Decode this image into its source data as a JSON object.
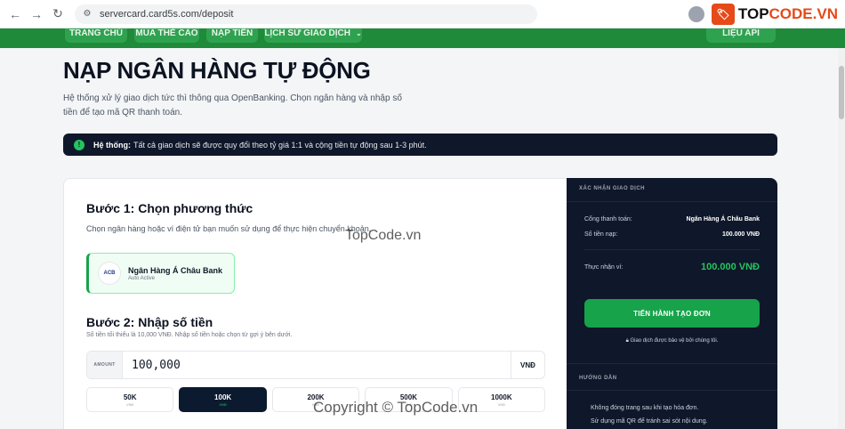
{
  "browser": {
    "url": "servercard.card5s.com/deposit"
  },
  "brand": {
    "mark": "🏷",
    "name_prefix": "TOP",
    "name_suffix": "CODE.VN"
  },
  "nav": {
    "items": [
      "TRANG CHỦ",
      "MUA THẺ CÀO",
      "NẠP TIỀN",
      "LỊCH SỬ GIAO DỊCH"
    ],
    "api_label": "LIỆU API"
  },
  "page": {
    "title": "NẠP NGÂN HÀNG TỰ ĐỘNG",
    "description": "Hệ thống xử lý giao dịch tức thì thông qua OpenBanking. Chọn ngân hàng và nhập số tiền để tạo mã QR thanh toán."
  },
  "notice": {
    "label": "Hệ thống:",
    "text": "Tất cả giao dịch sẽ được quy đổi theo tỷ giá 1:1 và cộng tiền tự động sau 1-3 phút."
  },
  "step1": {
    "title": "Bước 1: Chọn phương thức",
    "description": "Chọn ngân hàng hoặc ví điện tử bạn muốn sử dụng để thực hiện chuyển khoản.",
    "bank": {
      "logo": "ACB",
      "name": "Ngân Hàng Á Châu Bank",
      "status": "Auto Active"
    }
  },
  "step2": {
    "title": "Bước 2: Nhập số tiền",
    "hint": "Số tiền tối thiểu là 10,000 VNĐ. Nhập số tiền hoặc chọn từ gợi ý bên dưới.",
    "amount_label": "AMOUNT",
    "amount_value": "100,000",
    "amount_unit": "VNĐ",
    "presets": [
      {
        "amount": "50K",
        "unit": "VNĐ",
        "active": false
      },
      {
        "amount": "100K",
        "unit": "VNĐ",
        "active": true
      },
      {
        "amount": "200K",
        "unit": "VNĐ",
        "active": false
      },
      {
        "amount": "500K",
        "unit": "VNĐ",
        "active": false
      },
      {
        "amount": "1000K",
        "unit": "VNĐ",
        "active": false
      }
    ]
  },
  "summary": {
    "heading": "XÁC NHẬN GIAO DỊCH",
    "gateway_label": "Cổng thanh toán:",
    "gateway_value": "Ngân Hàng Á Châu Bank",
    "amount_label": "Số tiền nạp:",
    "amount_value": "100.000 VNĐ",
    "receive_label": "Thực nhận ví:",
    "receive_value": "100.000 VNĐ",
    "submit_label": "TIẾN HÀNH TẠO ĐƠN",
    "secure_note": "Giao dịch được bảo vệ bởi chúng tôi."
  },
  "guide": {
    "heading": "HƯỚNG DẪN",
    "lines": [
      "Không đóng trang sau khi tạo hóa đơn.",
      "Sử dụng mã QR để tránh sai sót nội dung."
    ]
  },
  "watermarks": {
    "middle": "TopCode.vn",
    "bottom": "Copyright © TopCode.vn"
  },
  "colors": {
    "nav_green": "#1f8a3a",
    "accent_green": "#16a34a",
    "dark_panel": "#0f172a"
  }
}
